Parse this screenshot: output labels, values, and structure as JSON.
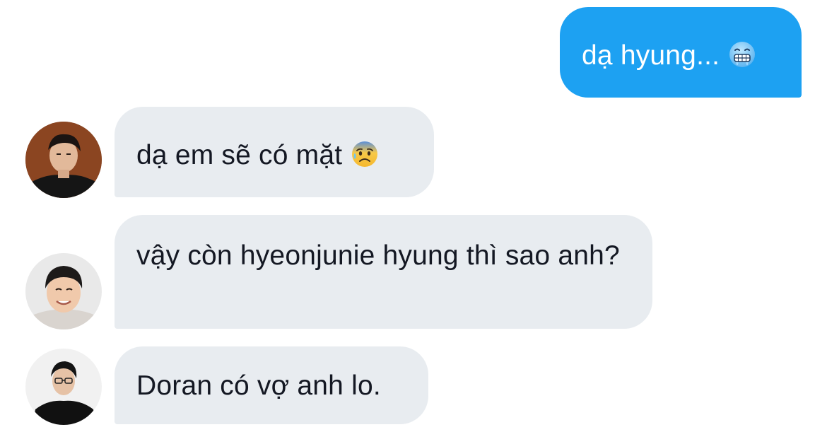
{
  "conversation": {
    "messages": [
      {
        "direction": "outgoing",
        "text": "dạ hyung...",
        "emoji": "cold-face-icon"
      },
      {
        "direction": "incoming",
        "text": "dạ em sẽ có mặt",
        "emoji": "anxious-sweat-face-icon",
        "avatar": "avatar-1"
      },
      {
        "direction": "incoming",
        "text": "vậy còn hyeonjunie hyung thì sao anh?",
        "avatar": "avatar-2"
      },
      {
        "direction": "incoming",
        "text": "Doran có vợ anh lo.",
        "avatar": "avatar-3"
      }
    ]
  },
  "colors": {
    "outgoing_bubble": "#1da1f2",
    "incoming_bubble": "#e8ecf0",
    "outgoing_text": "#ffffff",
    "incoming_text": "#141823"
  }
}
